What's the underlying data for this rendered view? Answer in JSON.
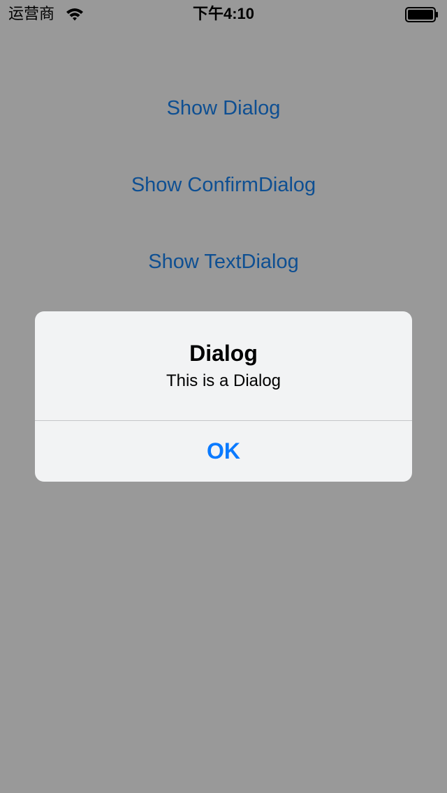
{
  "status_bar": {
    "carrier": "运营商",
    "time": "下午4:10",
    "wifi_icon": "wifi-icon",
    "battery_icon": "battery-icon"
  },
  "menu": {
    "show_dialog": "Show Dialog",
    "show_confirm_dialog": "Show ConfirmDialog",
    "show_text_dialog": "Show TextDialog"
  },
  "dialog": {
    "title": "Dialog",
    "message": "This is a Dialog",
    "ok_label": "OK"
  },
  "colors": {
    "background_dim": "#999999",
    "link_blue": "#0e4f92",
    "ok_blue": "#0a7aff",
    "dialog_bg": "#f2f3f4"
  }
}
